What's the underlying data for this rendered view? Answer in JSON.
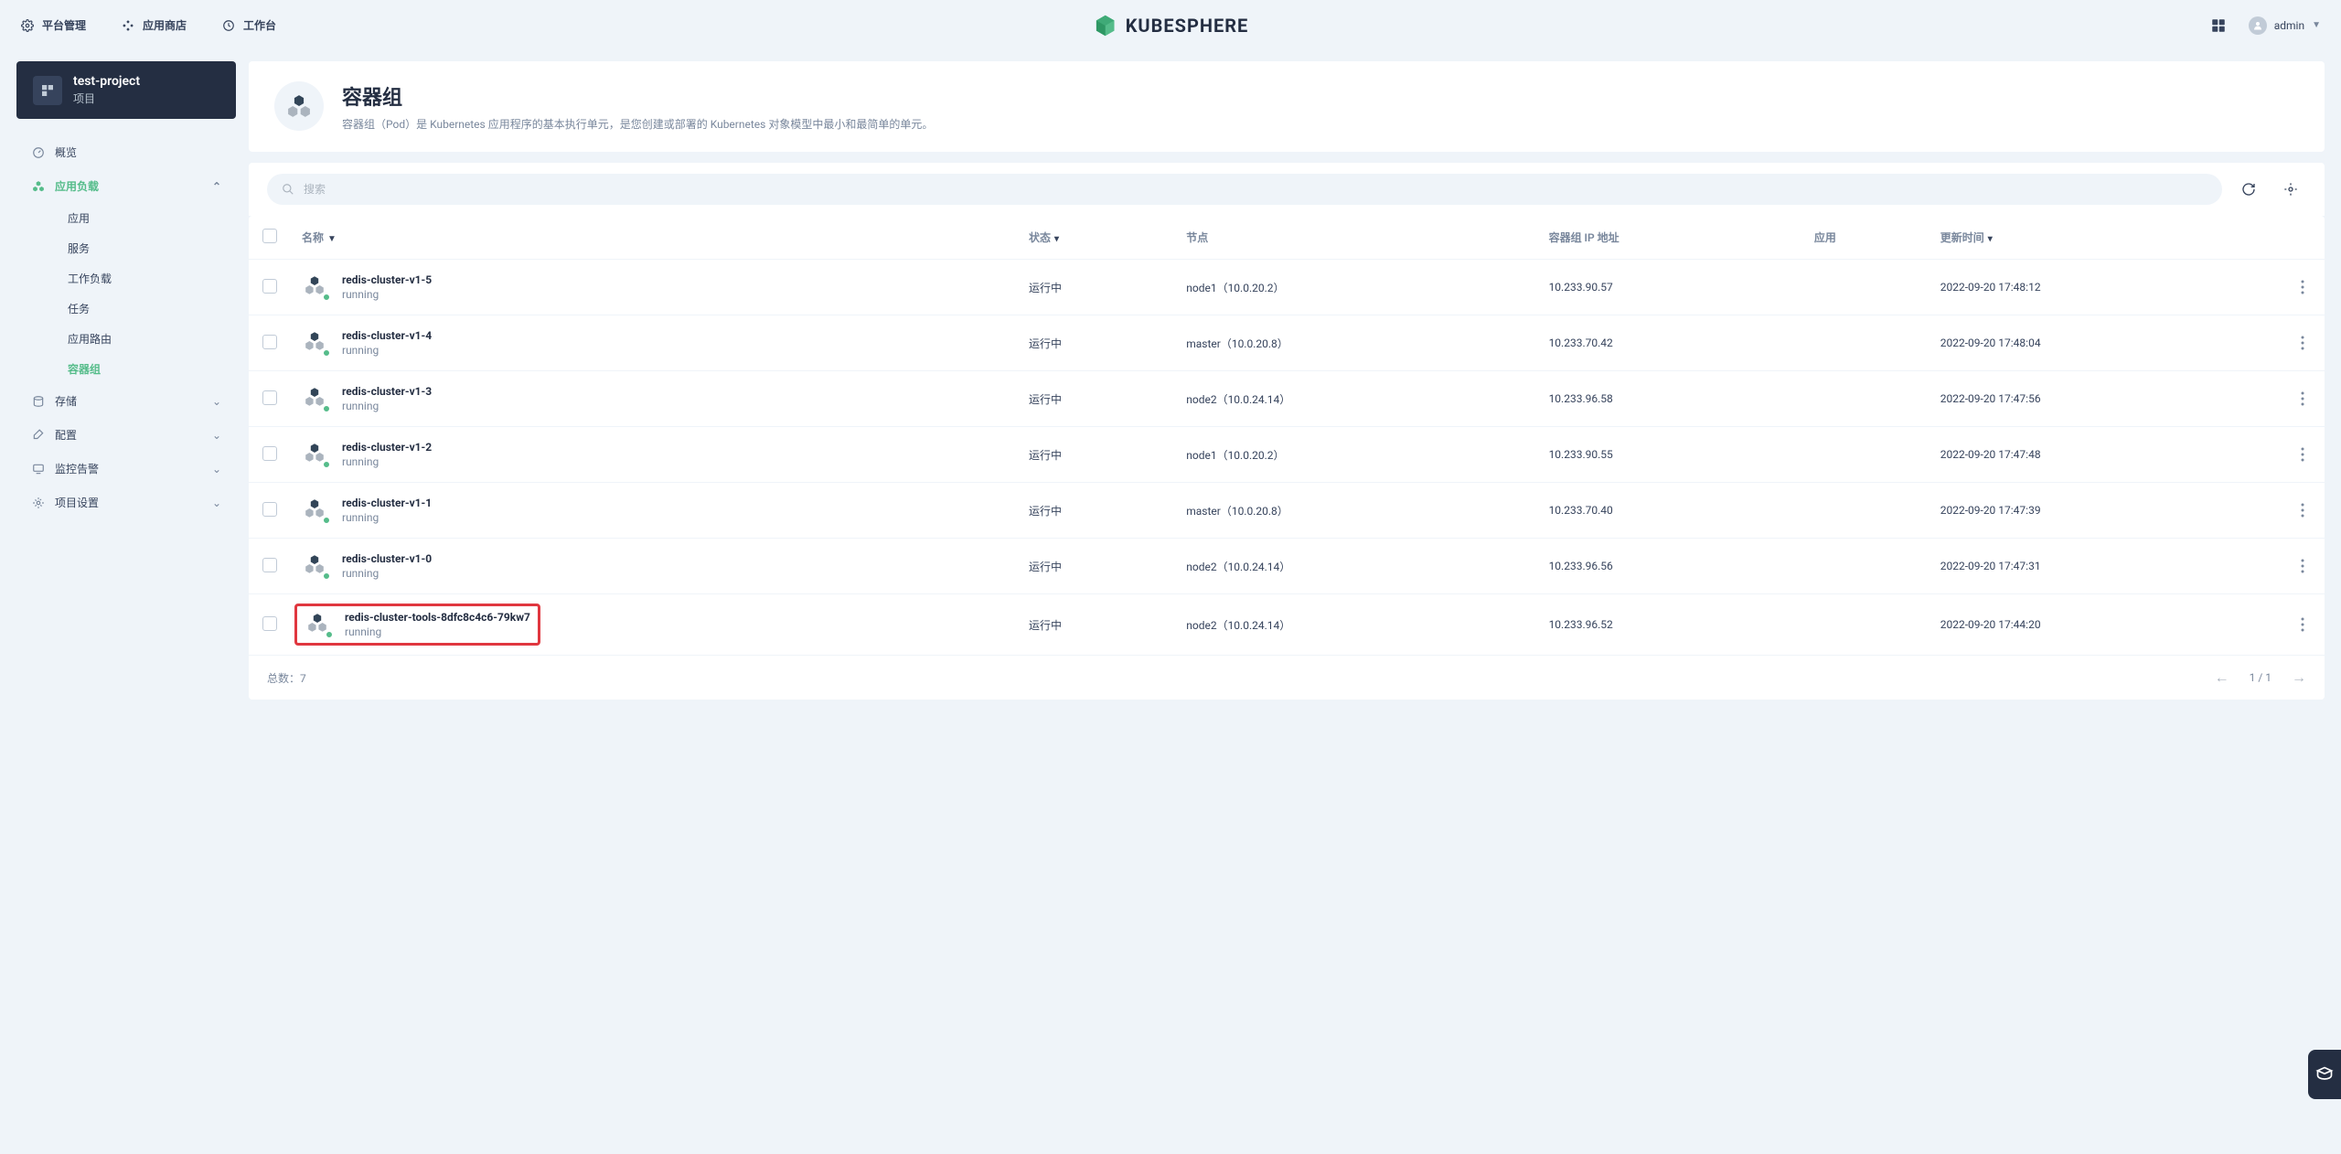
{
  "topbar": {
    "platform": "平台管理",
    "appstore": "应用商店",
    "workbench": "工作台",
    "brand": "KUBESPHERE",
    "user": "admin"
  },
  "project": {
    "name": "test-project",
    "sub": "项目"
  },
  "nav": {
    "overview": "概览",
    "workloads": "应用负载",
    "sub": {
      "app": "应用",
      "service": "服务",
      "workload": "工作负载",
      "job": "任务",
      "route": "应用路由",
      "pod": "容器组"
    },
    "storage": "存储",
    "config": "配置",
    "monitor": "监控告警",
    "settings": "项目设置"
  },
  "page": {
    "title": "容器组",
    "desc": "容器组（Pod）是 Kubernetes 应用程序的基本执行单元，是您创建或部署的 Kubernetes 对象模型中最小和最简单的单元。"
  },
  "search": {
    "placeholder": "搜索"
  },
  "columns": {
    "name": "名称",
    "status": "状态",
    "node": "节点",
    "ip": "容器组 IP 地址",
    "app": "应用",
    "updated": "更新时间"
  },
  "rows": [
    {
      "name": "redis-cluster-v1-5",
      "state": "running",
      "status": "运行中",
      "node": "node1（10.0.20.2）",
      "ip": "10.233.90.57",
      "app": "",
      "updated": "2022-09-20 17:48:12",
      "highlight": false
    },
    {
      "name": "redis-cluster-v1-4",
      "state": "running",
      "status": "运行中",
      "node": "master（10.0.20.8）",
      "ip": "10.233.70.42",
      "app": "",
      "updated": "2022-09-20 17:48:04",
      "highlight": false
    },
    {
      "name": "redis-cluster-v1-3",
      "state": "running",
      "status": "运行中",
      "node": "node2（10.0.24.14）",
      "ip": "10.233.96.58",
      "app": "",
      "updated": "2022-09-20 17:47:56",
      "highlight": false
    },
    {
      "name": "redis-cluster-v1-2",
      "state": "running",
      "status": "运行中",
      "node": "node1（10.0.20.2）",
      "ip": "10.233.90.55",
      "app": "",
      "updated": "2022-09-20 17:47:48",
      "highlight": false
    },
    {
      "name": "redis-cluster-v1-1",
      "state": "running",
      "status": "运行中",
      "node": "master（10.0.20.8）",
      "ip": "10.233.70.40",
      "app": "",
      "updated": "2022-09-20 17:47:39",
      "highlight": false
    },
    {
      "name": "redis-cluster-v1-0",
      "state": "running",
      "status": "运行中",
      "node": "node2（10.0.24.14）",
      "ip": "10.233.96.56",
      "app": "",
      "updated": "2022-09-20 17:47:31",
      "highlight": false
    },
    {
      "name": "redis-cluster-tools-8dfc8c4c6-79kw7",
      "state": "running",
      "status": "运行中",
      "node": "node2（10.0.24.14）",
      "ip": "10.233.96.52",
      "app": "",
      "updated": "2022-09-20 17:44:20",
      "highlight": true
    }
  ],
  "footer": {
    "total_label": "总数：",
    "total": 7,
    "page": "1 / 1"
  }
}
